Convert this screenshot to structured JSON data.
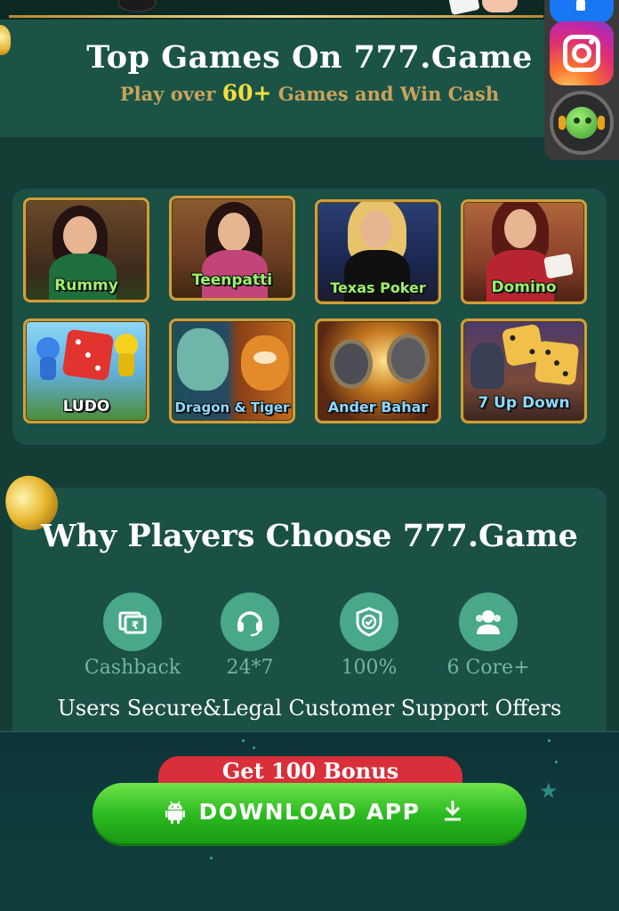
{
  "header": {
    "title": "Top Games On 777.Game",
    "subtitle_before": "Play over",
    "subtitle_highlight": "60+",
    "subtitle_after": "Games and Win Cash"
  },
  "social": {
    "items": [
      {
        "icon": "facebook-icon"
      },
      {
        "icon": "instagram-icon"
      },
      {
        "icon": "customer-support-icon"
      }
    ]
  },
  "games": [
    {
      "label": "Rummy",
      "color": "#9cf06a"
    },
    {
      "label": "Teenpatti",
      "color": "#9cf06a"
    },
    {
      "label": "Texas Poker",
      "color": "#9cf06a"
    },
    {
      "label": "Domino",
      "color": "#9cf06a"
    },
    {
      "label": "LUDO",
      "color": "#ffffff"
    },
    {
      "label": "Dragon & Tiger",
      "color": "#8fd8ff"
    },
    {
      "label": "Ander Bahar",
      "color": "#8fd8ff"
    },
    {
      "label": "7 Up Down",
      "color": "#8fd8ff"
    }
  ],
  "why": {
    "title": "Why Players Choose 777.Game",
    "features": [
      {
        "label": "Cashback",
        "icon": "cashback-icon"
      },
      {
        "label": "24*7",
        "icon": "headset-icon"
      },
      {
        "label": "100%",
        "icon": "shield-check-icon"
      },
      {
        "label": "6 Core+",
        "icon": "users-icon"
      }
    ],
    "bottom_line": "Users Secure&Legal Customer Support Offers"
  },
  "download": {
    "bonus_label": "Get 100 Bonus",
    "button_label": "DOWNLOAD APP"
  },
  "colors": {
    "background": "#143d36",
    "panel": "#1b5045",
    "accent_gold": "#cf9f3c",
    "download_green": "#29b81f",
    "bonus_red": "#d92f3a"
  }
}
